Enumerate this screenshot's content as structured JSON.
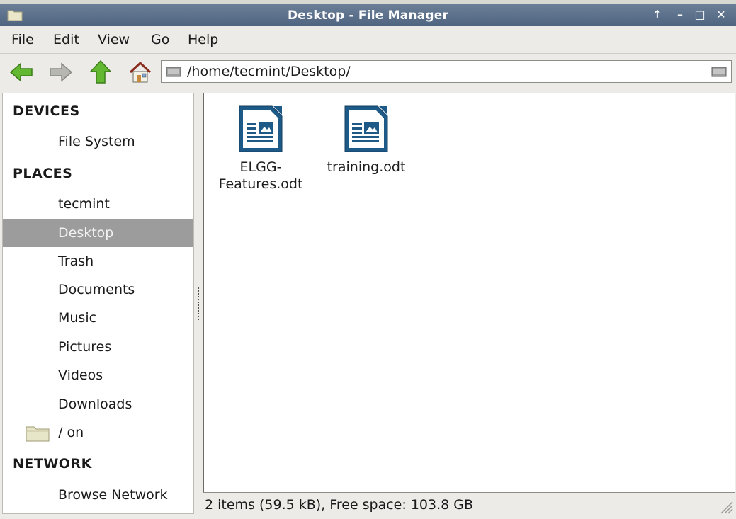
{
  "window": {
    "title": "Desktop - File Manager",
    "controls": [
      "↑",
      "–",
      "□",
      "✕"
    ]
  },
  "menu": [
    "File",
    "Edit",
    "View",
    "Go",
    "Help"
  ],
  "toolbar": {
    "location": "/home/tecmint/Desktop/"
  },
  "sidebar": {
    "devices_header": "DEVICES",
    "devices": [
      "File System"
    ],
    "places_header": "PLACES",
    "places": [
      "tecmint",
      "Desktop",
      "Trash",
      "Documents",
      "Music",
      "Pictures",
      "Videos",
      "Downloads",
      "/ on"
    ],
    "selected": "Desktop",
    "network_header": "NETWORK",
    "network": [
      "Browse Network"
    ]
  },
  "files": [
    {
      "name_line1": "ELGG-",
      "name_line2": "Features.odt",
      "icon": "odt-document-icon"
    },
    {
      "name_line1": "training.odt",
      "name_line2": "",
      "icon": "odt-document-icon"
    }
  ],
  "status": "2 items (59.5 kB), Free space: 103.8 GB",
  "colors": {
    "titlebar": "#5a6e89",
    "selected_row": "#9c9c9c",
    "arrow_green": "#5fb82f",
    "doc_blue": "#1e5a87"
  }
}
